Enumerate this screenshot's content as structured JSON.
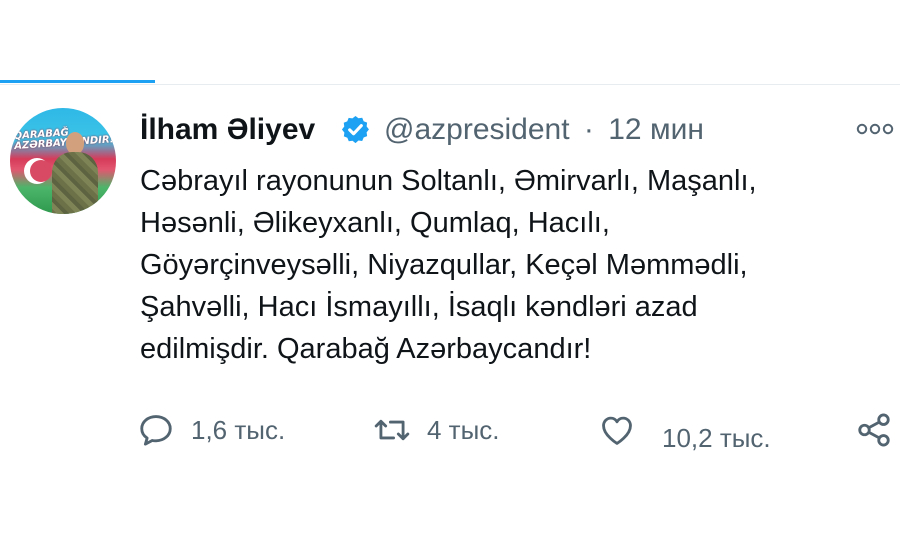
{
  "tweet": {
    "author": {
      "display_name": "İlham Əliyev",
      "handle": "@azpresident",
      "verified": true,
      "avatar_text": "QARABAĞ AZƏRBAYCANDIR!"
    },
    "time_separator": "·",
    "time": "12 мин",
    "text_lines": [
      "Cəbrayıl rayonunun Soltanlı, Əmirvarlı, Maşanlı,",
      "Həsənli, Əlikeyxanlı, Qumlaq, Hacılı,",
      "Göyərçinveysəlli, Niyazqullar, Keçəl Məmmədli,",
      "Şahvəlli, Hacı İsmayıllı, İsaqlı kəndləri azad",
      "edilmişdir. Qarabağ Azərbaycandır!"
    ],
    "actions": {
      "reply": {
        "icon": "reply-icon",
        "count": "1,6 тыс."
      },
      "retweet": {
        "icon": "retweet-icon",
        "count": "4 тыс."
      },
      "like": {
        "icon": "heart-icon",
        "count": "10,2 тыс."
      },
      "share": {
        "icon": "share-icon"
      }
    }
  },
  "colors": {
    "accent": "#1da1f2",
    "text": "#0f1419",
    "secondary_text": "#536471"
  }
}
